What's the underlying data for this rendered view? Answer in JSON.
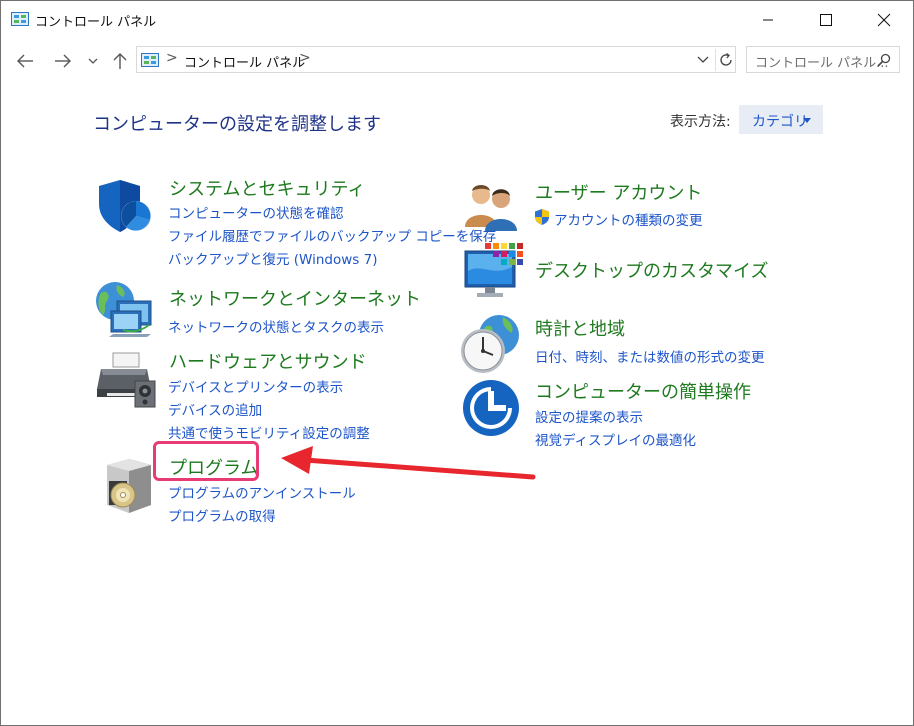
{
  "window": {
    "title": "コントロール パネル"
  },
  "address": {
    "crumb": "コントロール パネル",
    "separator": ">"
  },
  "search": {
    "placeholder": "コントロール パネル..."
  },
  "content": {
    "heading": "コンピューターの設定を調整します",
    "view_label": "表示方法:",
    "view_value": "カテゴリ"
  },
  "categories": {
    "system": {
      "title": "システムとセキュリティ",
      "links": [
        "コンピューターの状態を確認",
        "ファイル履歴でファイルのバックアップ コピーを保存",
        "バックアップと復元 (Windows 7)"
      ]
    },
    "network": {
      "title": "ネットワークとインターネット",
      "links": [
        "ネットワークの状態とタスクの表示"
      ]
    },
    "hardware": {
      "title": "ハードウェアとサウンド",
      "links": [
        "デバイスとプリンターの表示",
        "デバイスの追加",
        "共通で使うモビリティ設定の調整"
      ]
    },
    "programs": {
      "title": "プログラム",
      "links": [
        "プログラムのアンインストール",
        "プログラムの取得"
      ]
    },
    "users": {
      "title": "ユーザー アカウント",
      "links": [
        "アカウントの種類の変更"
      ]
    },
    "appearance": {
      "title": "デスクトップのカスタマイズ",
      "links": []
    },
    "clock": {
      "title": "時計と地域",
      "links": [
        "日付、時刻、または数値の形式の変更"
      ]
    },
    "ease": {
      "title": "コンピューターの簡単操作",
      "links": [
        "設定の提案の表示",
        "視覚ディスプレイの最適化"
      ]
    }
  },
  "colors": {
    "category_title": "#1e7a1e",
    "link": "#1d55c8",
    "heading": "#1e3287",
    "highlight": "#e83a73",
    "arrow": "#e8262e"
  }
}
